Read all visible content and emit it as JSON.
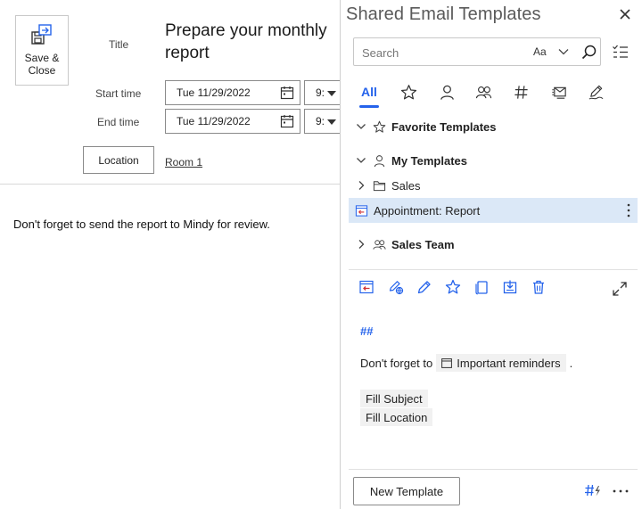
{
  "form": {
    "save_close_line1": "Save &",
    "save_close_line2": "Close",
    "title_label": "Title",
    "title_value": "Prepare your monthly report",
    "start_label": "Start time",
    "start_date": "Tue 11/29/2022",
    "start_time": "9:",
    "end_label": "End time",
    "end_date": "Tue 11/29/2022",
    "end_time": "9:",
    "location_button": "Location",
    "location_value": "Room 1",
    "body": "Don't forget to send the report to Mindy for review."
  },
  "pane": {
    "title": "Shared Email Templates",
    "search_placeholder": "Search",
    "match_case_label": "Aa",
    "tabs": [
      {
        "label": "All",
        "icon": "all",
        "active": true
      },
      {
        "label": "",
        "icon": "star-icon"
      },
      {
        "label": "",
        "icon": "person-icon"
      },
      {
        "label": "",
        "icon": "people-icon"
      },
      {
        "label": "",
        "icon": "hash-icon"
      },
      {
        "label": "",
        "icon": "template-icon"
      },
      {
        "label": "",
        "icon": "pen-edit-icon"
      }
    ],
    "tree": [
      {
        "label": "Favorite Templates",
        "bold": true,
        "icon": "star-icon",
        "expanded": true
      },
      {
        "label": "My Templates",
        "bold": true,
        "icon": "person-icon",
        "expanded": true
      },
      {
        "label": "Sales",
        "bold": false,
        "icon": "folder-icon",
        "expanded": false
      },
      {
        "label": "Appointment: Report",
        "bold": false,
        "icon": "appointment-icon",
        "selected": true
      },
      {
        "label": "Sales Team",
        "bold": true,
        "icon": "people-icon",
        "expanded": false
      }
    ],
    "preview": {
      "hashmark": "##",
      "line_prefix": "Don't forget to",
      "chip_label": "Important reminders",
      "line_suffix": ".",
      "fill_subject": "Fill Subject",
      "fill_location": "Fill Location"
    },
    "new_template_button": "New Template"
  },
  "colors": {
    "accent": "#2563eb",
    "selected_bg": "#dbe8f7",
    "insert_red": "#d13438"
  }
}
